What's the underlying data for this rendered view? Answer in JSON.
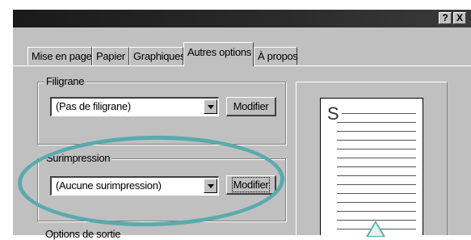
{
  "titlebar": {
    "help_label": "?",
    "close_label": "X"
  },
  "tabs": [
    {
      "label": "Mise en page",
      "active": false
    },
    {
      "label": "Papier",
      "active": false
    },
    {
      "label": "Graphiques",
      "active": false
    },
    {
      "label": "Autres options",
      "active": true
    },
    {
      "label": "À propos",
      "active": false
    }
  ],
  "watermark": {
    "group_label": "Filigrane",
    "selected": "(Pas de filigrane)",
    "button_label": "Modifier"
  },
  "overlay": {
    "group_label": "Surimpression",
    "selected": "(Aucune surimpression)",
    "button_label": "Modifier"
  },
  "output_options": {
    "group_label": "Options de sortie"
  },
  "preview": {
    "letter": "S"
  },
  "annotation": {
    "highlight_color": "#5aaaad"
  }
}
